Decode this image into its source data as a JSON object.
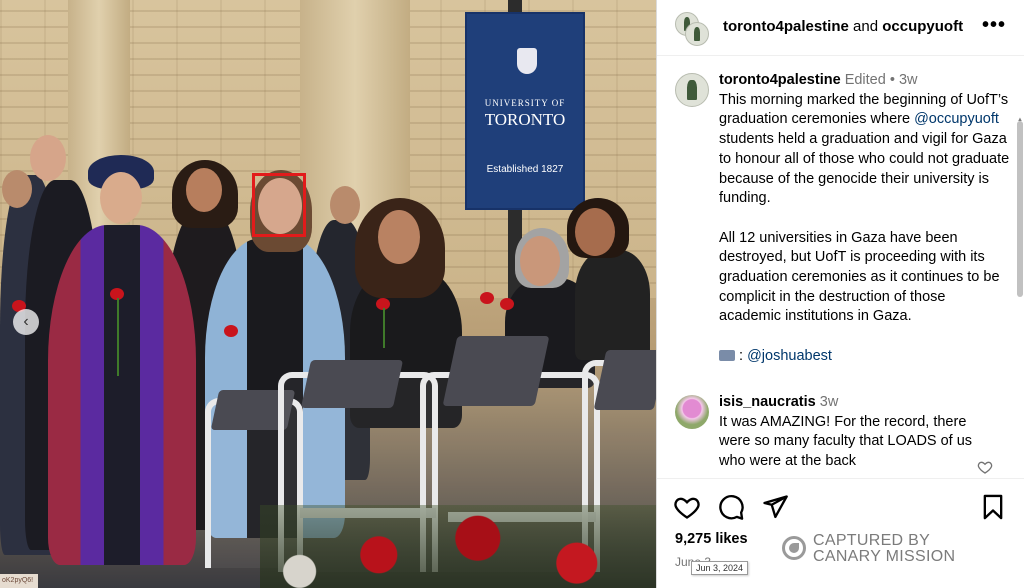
{
  "header": {
    "author": "toronto4palestine",
    "joiner": " and ",
    "coauthor": "occupyuoft",
    "more_icon": "more-horizontal-icon"
  },
  "photo": {
    "banner": {
      "university": "UNIVERSITY OF",
      "city": "TORONTO",
      "established": "Established 1827"
    },
    "nav_icon": "chevron-left-icon",
    "highlight_color": "#e21b1b",
    "corner_tag": "oK2pyQ6!"
  },
  "caption": {
    "username": "toronto4palestine",
    "edited": "Edited",
    "dot": "•",
    "age": "3w",
    "paragraph1": "This morning marked the beginning of UofT’s graduation ceremonies where",
    "mention1": "@occupyuoft",
    "paragraph1_rest": "students held a graduation and vigil for Gaza to honour all of those who could not graduate because of the genocide their university is funding.",
    "paragraph2": "All 12 universities in Gaza have been destroyed, but UofT is proceeding with its graduation ceremonies as it continues to be complicit in the destruction of those academic institutions in Gaza.",
    "camera_icon": "camera-emoji-icon",
    "separator": ":",
    "photo_credit": "@joshuabest"
  },
  "comment": {
    "username": "isis_naucratis",
    "age": "3w",
    "text": "It was AMAZING! For the record, there were so many faculty that LOADS of us who were at the back",
    "like_icon": "heart-outline-icon"
  },
  "actions": {
    "like_icon": "heart-icon",
    "comment_icon": "comment-icon",
    "share_icon": "send-icon",
    "save_icon": "bookmark-icon",
    "likes": "9,275 likes",
    "date": "June 3",
    "date_tooltip": "Jun 3, 2024"
  },
  "watermark": {
    "line1": "CAPTURED BY",
    "line2": "CANARY MISSION"
  },
  "colors": {
    "mention": "#00376b",
    "muted": "#737373",
    "highlight": "#e21b1b"
  }
}
